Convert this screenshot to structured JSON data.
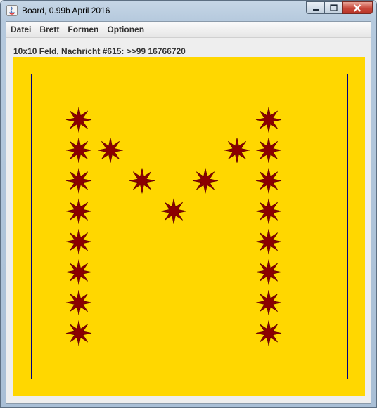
{
  "window": {
    "title": "Board, 0.99b April 2016"
  },
  "menu": {
    "items": [
      {
        "label": "Datei"
      },
      {
        "label": "Brett"
      },
      {
        "label": "Formen"
      },
      {
        "label": "Optionen"
      }
    ]
  },
  "status": {
    "text": "10x10 Feld, Nachricht #615: >>99 16766720"
  },
  "board": {
    "rows": 10,
    "cols": 10,
    "background_color": "#FFD700",
    "star_color": "#8B0000",
    "grid_outline_color": "#000080",
    "stars": [
      {
        "col": 1,
        "row": 1
      },
      {
        "col": 1,
        "row": 2
      },
      {
        "col": 1,
        "row": 3
      },
      {
        "col": 1,
        "row": 4
      },
      {
        "col": 1,
        "row": 5
      },
      {
        "col": 1,
        "row": 6
      },
      {
        "col": 1,
        "row": 7
      },
      {
        "col": 1,
        "row": 8
      },
      {
        "col": 2,
        "row": 2
      },
      {
        "col": 3,
        "row": 3
      },
      {
        "col": 4,
        "row": 4
      },
      {
        "col": 5,
        "row": 3
      },
      {
        "col": 6,
        "row": 2
      },
      {
        "col": 7,
        "row": 1
      },
      {
        "col": 7,
        "row": 2
      },
      {
        "col": 7,
        "row": 3
      },
      {
        "col": 7,
        "row": 4
      },
      {
        "col": 7,
        "row": 5
      },
      {
        "col": 7,
        "row": 6
      },
      {
        "col": 7,
        "row": 7
      },
      {
        "col": 7,
        "row": 8
      }
    ]
  }
}
